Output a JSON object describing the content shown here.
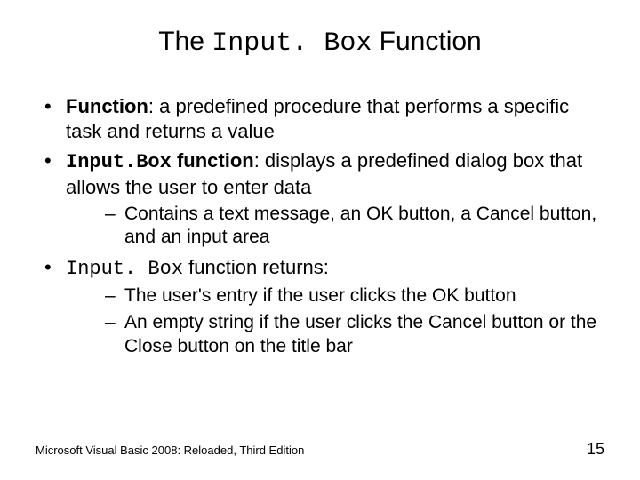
{
  "title": {
    "pre": "The ",
    "mono": "Input. Box",
    "post": " Function"
  },
  "bullets": {
    "b1": {
      "term": "Function",
      "rest": ": a predefined procedure that performs a specific task and returns a value"
    },
    "b2": {
      "mono": "Input.Box",
      "bold_rest": " function",
      "rest": ": displays a predefined dialog box that allows the user to enter data"
    },
    "b2_sub1": "Contains a text message, an OK button, a Cancel button, and an input area",
    "b3": {
      "mono": "Input. Box",
      "rest": " function returns:"
    },
    "b3_sub1": "The user's entry if the user clicks the OK button",
    "b3_sub2": "An empty string if the user clicks the Cancel button or the Close button on the title bar"
  },
  "footer": {
    "text": "Microsoft Visual Basic 2008: Reloaded, Third Edition",
    "page": "15"
  }
}
